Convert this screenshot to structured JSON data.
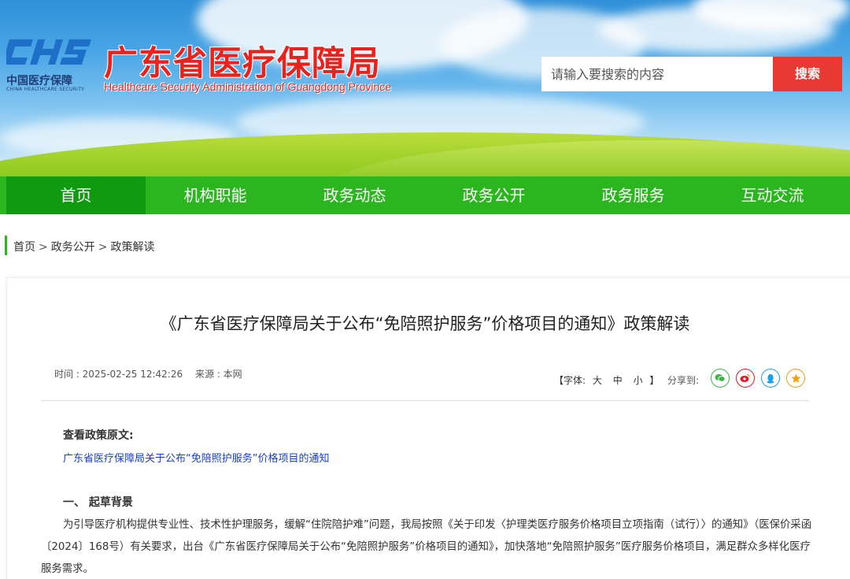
{
  "header": {
    "logo_mark": "CHS",
    "logo_cn": "中国医疗保障",
    "logo_en": "CHINA HEALTHCARE SECURITY",
    "title_cn": "广东省医疗保障局",
    "title_en": "Healthcare Security Administration of Guangdong Province",
    "search_placeholder": "请输入要搜索的内容",
    "search_button": "搜索"
  },
  "nav": {
    "items": [
      {
        "label": "首页",
        "active": true
      },
      {
        "label": "机构职能"
      },
      {
        "label": "政务动态"
      },
      {
        "label": "政务公开"
      },
      {
        "label": "政务服务"
      },
      {
        "label": "互动交流"
      }
    ]
  },
  "breadcrumb": [
    "首页",
    "政务公开",
    "政策解读"
  ],
  "breadcrumb_sep": ">",
  "article": {
    "title": "《广东省医疗保障局关于公布“免陪照护服务”价格项目的通知》政策解读",
    "time": "时间 : 2025-02-25 12:42:26",
    "source": "来源 : 本网",
    "font_size_label_open": "【字体:",
    "font_sizes": [
      "大",
      "中",
      "小"
    ],
    "font_size_label_close": "】",
    "share_label": "分享到:",
    "share_icons": [
      "wechat-icon",
      "weibo-icon",
      "qq-icon",
      "qzone-icon"
    ],
    "original_label": "查看政策原文:",
    "original_link": "广东省医疗保障局关于公布“免陪照护服务”价格项目的通知",
    "section1_heading": "一、 起草背景",
    "section1_para": "为引导医疗机构提供专业性、技术性护理服务，缓解“住院陪护难”问题，我局按照《关于印发〈护理类医疗服务价格项目立项指南（试行）〉的通知》（医保价采函〔2024〕168号）有关要求，出台《广东省医疗保障局关于公布“免陪照护服务”价格项目的通知》，加快落地“免陪照护服务”医疗服务价格项目，满足群众多样化医疗服务需求。"
  },
  "colors": {
    "nav_bg": "#2bb51e",
    "nav_active": "#109a10",
    "search_button": "#e83a33",
    "title_red": "#e8221c",
    "link_blue": "#1a3fc7"
  }
}
